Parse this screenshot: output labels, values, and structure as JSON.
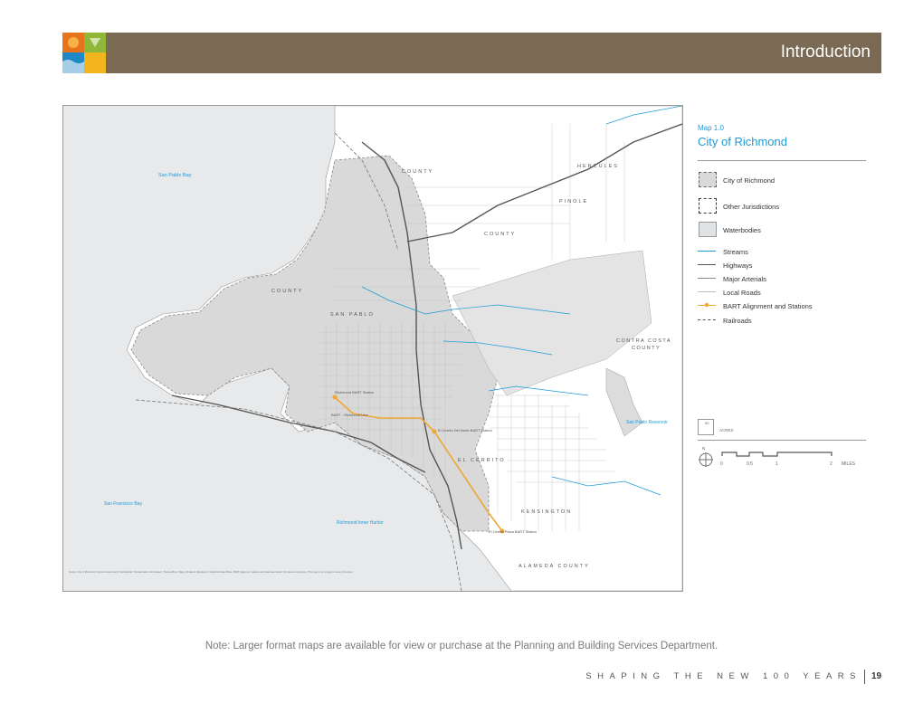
{
  "header": {
    "title": "Introduction"
  },
  "map": {
    "place_labels": {
      "san_pablo_bay": "San Pablo Bay",
      "hercules": "HERCULES",
      "pinole": "PINOLE",
      "county_1": "COUNTY",
      "county_2": "COUNTY",
      "county_3": "COUNTY",
      "san_pablo": "SAN PABLO",
      "contra_costa_1": "CONTRA COSTA",
      "contra_costa_2": "COUNTY",
      "richmond_station": "Richmond BART Station",
      "bart_line": "BART - Richmond Line",
      "del_norte_station": "El Cerrito Del Norte BART Station",
      "el_cerrito": "EL CERRITO",
      "san_pablo_reservoir": "San Pablo Reservoir",
      "kensington": "KENSINGTON",
      "plaza_station": "El Cerrito Plaza BART Station",
      "sf_bay": "San Francisco Bay",
      "inner_harbor": "Richmond Inner Harbor",
      "alameda_county": "ALAMEDA COUNTY",
      "source_note": "Source: City of Richmond; Contra Costa County; Metropolitan Transportation Commission; Thomas Bros. Maps; All data is displayed in California State Plane. BART alignment, stations and roads are shown for reference purposes. This map is not a legal or survey document."
    }
  },
  "legend": {
    "map_number": "Map 1.0",
    "title": "City of Richmond",
    "items": [
      {
        "label": "City of Richmond",
        "symbol": "dashed-box-gray"
      },
      {
        "label": "Other Jurisdictions",
        "symbol": "dashed-box"
      },
      {
        "label": "Waterbodies",
        "symbol": "water-box"
      },
      {
        "label": "Streams",
        "symbol": "line-stream",
        "color": "#1e9ad6"
      },
      {
        "label": "Highways",
        "symbol": "line-highway",
        "color": "#555555"
      },
      {
        "label": "Major Arterials",
        "symbol": "line-arterial",
        "color": "#777777"
      },
      {
        "label": "Local Roads",
        "symbol": "line-local",
        "color": "#aaaaaa"
      },
      {
        "label": "BART Alignment and Stations",
        "symbol": "line-bart",
        "color": "#f0a733"
      },
      {
        "label": "Railroads",
        "symbol": "line-rail",
        "color": "#555555"
      }
    ],
    "acres_label": "ACRES",
    "acres_value": "90",
    "north_label": "N",
    "scale_ticks": [
      "0",
      "0.5",
      "1",
      "2"
    ],
    "scale_unit": "MILES"
  },
  "note": "Note: Larger format maps are available for view or purchase at the Planning and Building Services Department.",
  "footer": {
    "text": "SHAPING THE NEW 100 YEARS",
    "page": "19"
  },
  "colors": {
    "header_bg": "#7a6a54",
    "accent_blue": "#1e9ad6",
    "bart": "#f0a733"
  }
}
